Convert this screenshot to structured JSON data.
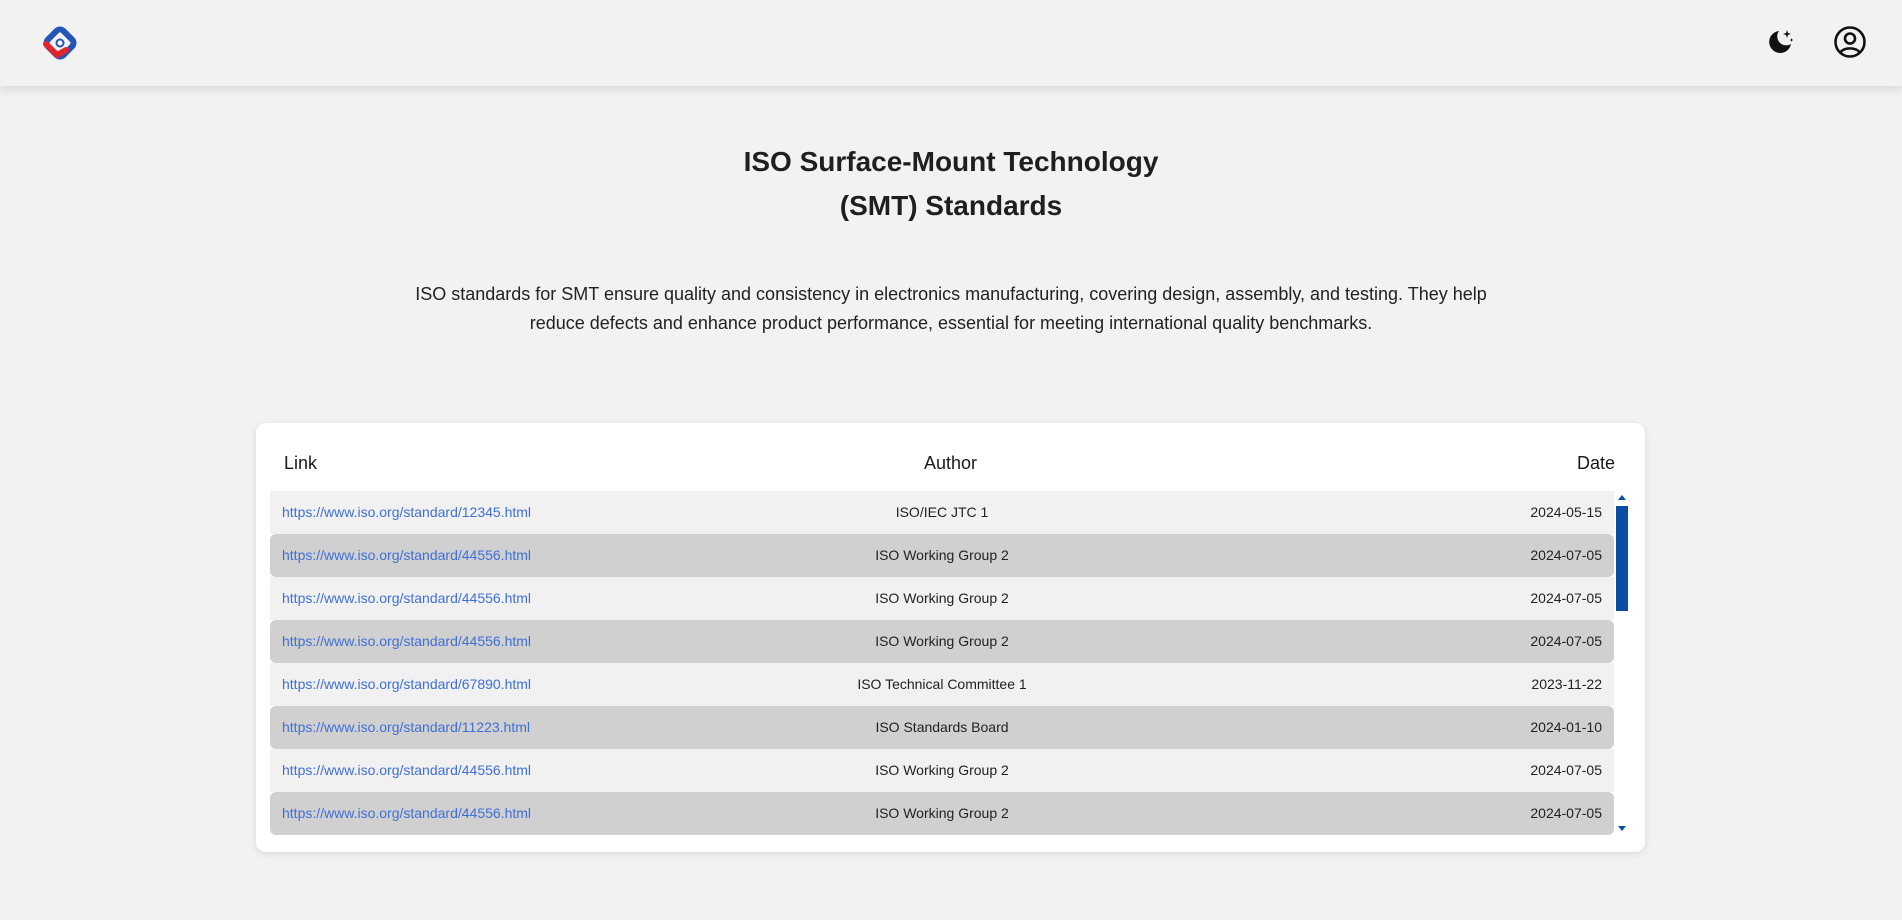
{
  "header": {
    "logo_icon": "app-logo-icon",
    "theme_toggle_icon": "moon-stars-icon",
    "account_icon": "user-circle-icon"
  },
  "page": {
    "title_line1": "ISO Surface-Mount Technology",
    "title_line2": "(SMT) Standards",
    "description": "ISO standards for SMT ensure quality and consistency in electronics manufacturing, covering design, assembly, and testing. They help reduce defects and enhance product performance, essential for meeting international quality benchmarks."
  },
  "table": {
    "columns": {
      "link": "Link",
      "author": "Author",
      "date": "Date"
    },
    "rows": [
      {
        "link": "https://www.iso.org/standard/12345.html",
        "author": "ISO/IEC JTC 1",
        "date": "2024-05-15"
      },
      {
        "link": "https://www.iso.org/standard/44556.html",
        "author": "ISO Working Group 2",
        "date": "2024-07-05"
      },
      {
        "link": "https://www.iso.org/standard/44556.html",
        "author": "ISO Working Group 2",
        "date": "2024-07-05"
      },
      {
        "link": "https://www.iso.org/standard/44556.html",
        "author": "ISO Working Group 2",
        "date": "2024-07-05"
      },
      {
        "link": "https://www.iso.org/standard/67890.html",
        "author": "ISO Technical Committee 1",
        "date": "2023-11-22"
      },
      {
        "link": "https://www.iso.org/standard/11223.html",
        "author": "ISO Standards Board",
        "date": "2024-01-10"
      },
      {
        "link": "https://www.iso.org/standard/44556.html",
        "author": "ISO Working Group 2",
        "date": "2024-07-05"
      },
      {
        "link": "https://www.iso.org/standard/44556.html",
        "author": "ISO Working Group 2",
        "date": "2024-07-05"
      }
    ]
  },
  "colors": {
    "link": "#3f6fd6",
    "accent": "#0a4ea3",
    "row_alt": "#d0d0d0",
    "background": "#f2f2f2"
  }
}
